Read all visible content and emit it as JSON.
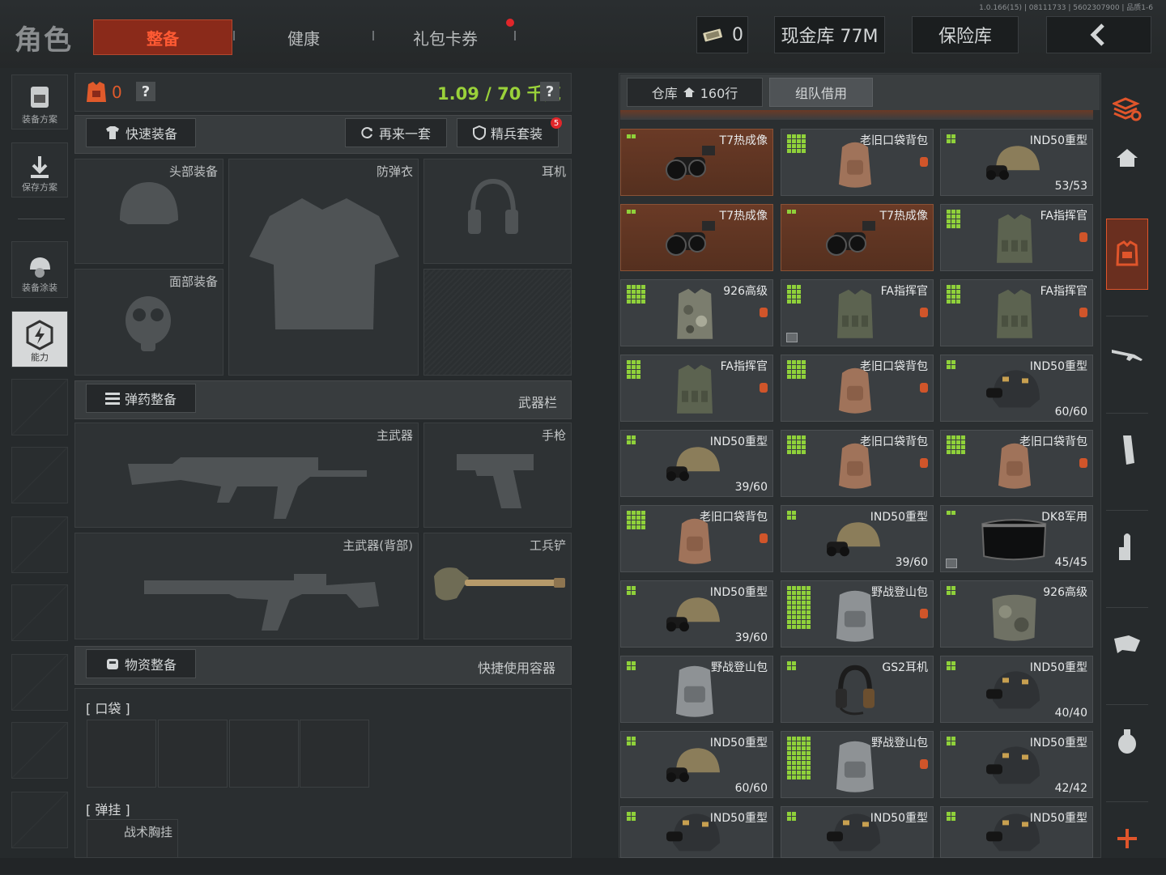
{
  "version": "1.0.166(15) | 08111733 | 5602307900 | 品质1-6",
  "title": "角色",
  "tabs": [
    {
      "label": "整备",
      "active": true
    },
    {
      "label": "健康"
    },
    {
      "label": "礼包卡券"
    }
  ],
  "currency": {
    "amount": "0"
  },
  "cash_vault": "现金库 77M",
  "insurance": "保险库",
  "left_rail": {
    "loadout_plan": "装备方案",
    "save_plan": "保存方案",
    "equip_paint": "装备涂装",
    "ability": "能力"
  },
  "gear": {
    "armor_count": "0",
    "weight": "1.09 / 70 千克",
    "quick_equip": "快速装备",
    "again": "再来一套",
    "elite_set": "精兵套装",
    "elite_badge": "5",
    "head": "头部装备",
    "vest": "防弹衣",
    "earphone": "耳机",
    "face": "面部装备"
  },
  "ammo": {
    "title": "弹药整备",
    "weapon_bar": "武器栏",
    "primary": "主武器",
    "pistol": "手枪",
    "primary_back": "主武器(背部)",
    "shovel": "工兵铲"
  },
  "supplies": {
    "title": "物资整备",
    "quick_container": "快捷使用容器",
    "pocket": "[ 口袋 ]",
    "rig": "[ 弹挂 ]",
    "tactical_rig": "战术胸挂"
  },
  "warehouse": {
    "tab": "仓库",
    "rows": "160行",
    "team_borrow": "组队借用"
  },
  "items": [
    {
      "name": "T7热成像",
      "count": "",
      "hl": true,
      "grid": [
        2,
        1
      ],
      "icon": "thermal"
    },
    {
      "name": "老旧口袋背包",
      "count": "",
      "grid": [
        4,
        4
      ],
      "icon": "backpack",
      "tag": true
    },
    {
      "name": "IND50重型",
      "count": "53/53",
      "grid": [
        2,
        2
      ],
      "icon": "helmet-tan"
    },
    {
      "name": "T7热成像",
      "count": "",
      "hl": true,
      "grid": [
        2,
        1
      ],
      "icon": "thermal"
    },
    {
      "name": "T7热成像",
      "count": "",
      "hl": true,
      "grid": [
        2,
        1
      ],
      "icon": "thermal"
    },
    {
      "name": "FA指挥官",
      "count": "",
      "grid": [
        3,
        4
      ],
      "icon": "vest",
      "tag": true
    },
    {
      "name": "926高级",
      "count": "",
      "grid": [
        4,
        4
      ],
      "icon": "vest-camo",
      "tag": true
    },
    {
      "name": "FA指挥官",
      "count": "",
      "grid": [
        3,
        4
      ],
      "icon": "vest",
      "tag": true,
      "cube": true
    },
    {
      "name": "FA指挥官",
      "count": "",
      "grid": [
        3,
        4
      ],
      "icon": "vest",
      "tag": true
    },
    {
      "name": "FA指挥官",
      "count": "",
      "grid": [
        3,
        4
      ],
      "icon": "vest",
      "tag": true
    },
    {
      "name": "老旧口袋背包",
      "count": "",
      "grid": [
        4,
        4
      ],
      "icon": "backpack",
      "tag": true
    },
    {
      "name": "IND50重型",
      "count": "60/60",
      "grid": [
        2,
        2
      ],
      "icon": "helmet-black"
    },
    {
      "name": "IND50重型",
      "count": "39/60",
      "grid": [
        2,
        2
      ],
      "icon": "helmet-tan"
    },
    {
      "name": "老旧口袋背包",
      "count": "",
      "grid": [
        4,
        4
      ],
      "icon": "backpack",
      "tag": true
    },
    {
      "name": "老旧口袋背包",
      "count": "",
      "grid": [
        4,
        4
      ],
      "icon": "backpack",
      "tag": true
    },
    {
      "name": "老旧口袋背包",
      "count": "",
      "grid": [
        4,
        4
      ],
      "icon": "backpack",
      "tag": true
    },
    {
      "name": "IND50重型",
      "count": "39/60",
      "grid": [
        2,
        2
      ],
      "icon": "helmet-tan"
    },
    {
      "name": "DK8军用",
      "count": "45/45",
      "grid": [
        2,
        1
      ],
      "icon": "visor",
      "cube": true
    },
    {
      "name": "IND50重型",
      "count": "39/60",
      "grid": [
        2,
        2
      ],
      "icon": "helmet-tan"
    },
    {
      "name": "野战登山包",
      "count": "",
      "grid": [
        5,
        9
      ],
      "icon": "pack-big",
      "tag": true
    },
    {
      "name": "926高级",
      "count": "",
      "grid": [
        2,
        2
      ],
      "icon": "bag-camo"
    },
    {
      "name": "野战登山包",
      "count": "",
      "grid": [
        2,
        2
      ],
      "icon": "pack-big"
    },
    {
      "name": "GS2耳机",
      "count": "",
      "grid": [
        2,
        2
      ],
      "icon": "headset"
    },
    {
      "name": "IND50重型",
      "count": "40/40",
      "grid": [
        2,
        2
      ],
      "icon": "helmet-black"
    },
    {
      "name": "IND50重型",
      "count": "60/60",
      "grid": [
        2,
        2
      ],
      "icon": "helmet-tan"
    },
    {
      "name": "野战登山包",
      "count": "",
      "grid": [
        5,
        9
      ],
      "icon": "pack-big",
      "tag": true
    },
    {
      "name": "IND50重型",
      "count": "42/42",
      "grid": [
        2,
        2
      ],
      "icon": "helmet-black"
    },
    {
      "name": "IND50重型",
      "count": "",
      "grid": [
        2,
        2
      ],
      "icon": "helmet-black"
    },
    {
      "name": "IND50重型",
      "count": "",
      "grid": [
        2,
        2
      ],
      "icon": "helmet-black"
    },
    {
      "name": "IND50重型",
      "count": "",
      "grid": [
        2,
        2
      ],
      "icon": "helmet-black"
    }
  ],
  "colors": {
    "accent": "#ff5a33",
    "accent_bg": "#8a2a1a",
    "weight_green": "#9ad23a",
    "grid_green": "#8fd13a"
  }
}
